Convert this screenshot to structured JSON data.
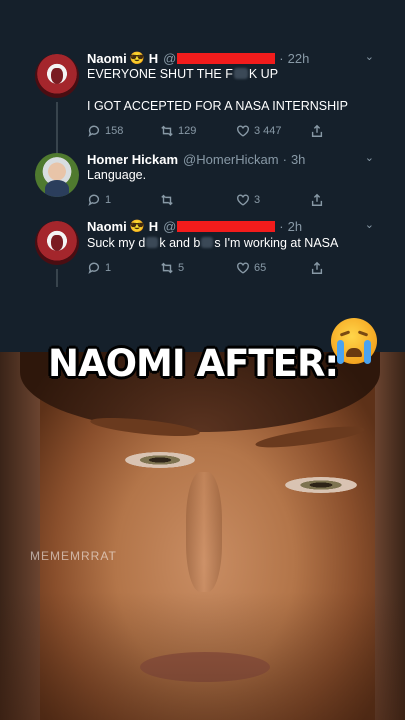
{
  "tweets": [
    {
      "name": "Naomi",
      "emoji": "😎",
      "badge": "H",
      "handle_prefix": "@",
      "separator": "·",
      "time": "22h",
      "line1": "EVERYONE SHUT THE F",
      "line1_end": "K UP",
      "line2": "I GOT ACCEPTED FOR A NASA INTERNSHIP",
      "replies": "158",
      "retweets": "129",
      "likes": "3 447"
    },
    {
      "name": "Homer Hickam",
      "handle": "@HomerHickam",
      "separator": "·",
      "time": "3h",
      "text": "Language.",
      "replies": "1",
      "retweets": "",
      "likes": "3"
    },
    {
      "name": "Naomi",
      "emoji": "😎",
      "badge": "H",
      "handle_prefix": "@",
      "separator": "·",
      "time": "2h",
      "text_a": "Suck my d",
      "text_b": "k and b",
      "text_c": "s I'm working at NASA",
      "replies": "1",
      "retweets": "5",
      "likes": "65"
    }
  ],
  "caption": "NAOMI AFTER:",
  "watermark": "MEMEMRRAT",
  "chevron": "⌄"
}
